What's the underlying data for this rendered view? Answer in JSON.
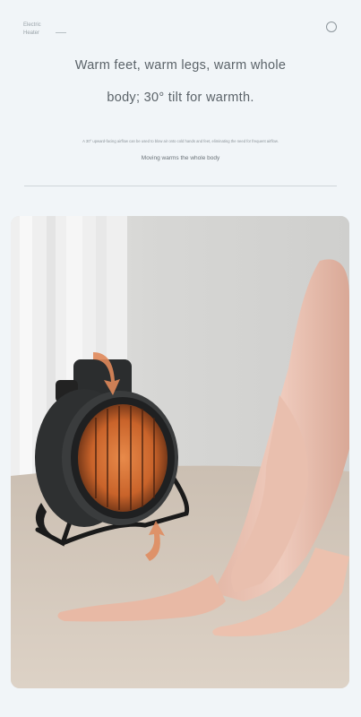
{
  "header": {
    "brand_line1": "Electric",
    "brand_line2": "Heater",
    "circle_icon": "circle-outline-icon"
  },
  "hero": {
    "headline_line1": "Warm feet, warm legs, warm whole",
    "headline_line2": "body; 30° tilt for warmth.",
    "description": "A 30° upward-facing airflow can be used to blow air onto cold hands and feet, eliminating the need for frequent airflow.",
    "subheading": "Moving warms the whole body"
  },
  "photo": {
    "subject": "product-photo-heater-and-legs"
  },
  "colors": {
    "background": "#f1f5f8",
    "accent_arrow": "#e0885a",
    "heater_glow": "#d0692b"
  }
}
